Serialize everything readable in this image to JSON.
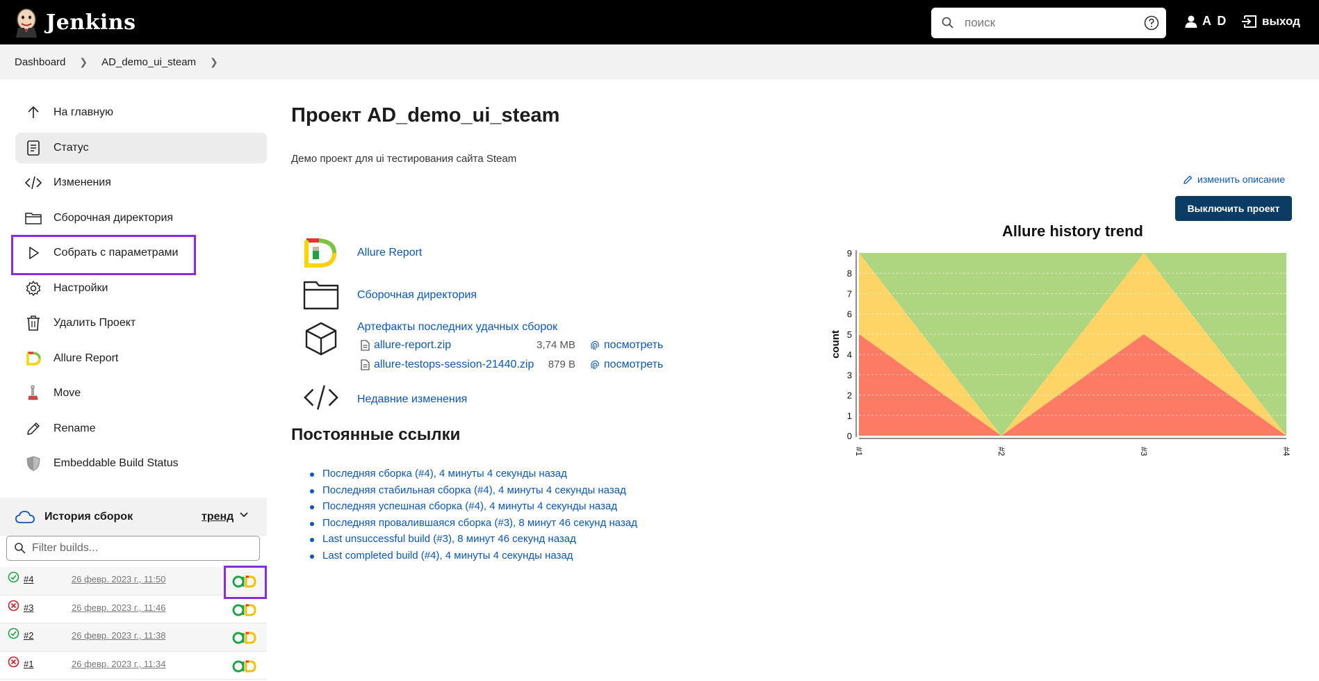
{
  "header": {
    "brand": "Jenkins",
    "search_placeholder": "поиск",
    "user": "A D",
    "logout": "выход"
  },
  "breadcrumb": [
    "Dashboard",
    "AD_demo_ui_steam"
  ],
  "sidebar": {
    "items": [
      {
        "label": "На главную",
        "icon": "arrow-up-icon"
      },
      {
        "label": "Статус",
        "icon": "document-icon",
        "active": true
      },
      {
        "label": "Изменения",
        "icon": "code-icon"
      },
      {
        "label": "Сборочная директория",
        "icon": "folder-icon"
      },
      {
        "label": "Собрать с параметрами",
        "icon": "play-icon",
        "highlighted": true
      },
      {
        "label": "Настройки",
        "icon": "gear-icon"
      },
      {
        "label": "Удалить Проект",
        "icon": "trash-icon"
      },
      {
        "label": "Allure Report",
        "icon": "allure-icon"
      },
      {
        "label": "Move",
        "icon": "move-icon"
      },
      {
        "label": "Rename",
        "icon": "pencil-icon"
      },
      {
        "label": "Embeddable Build Status",
        "icon": "shield-icon"
      }
    ]
  },
  "history": {
    "title": "История сборок",
    "trend": "тренд",
    "filter_placeholder": "Filter builds...",
    "builds": [
      {
        "num": "#4",
        "date": "26 февр. 2023 г., 11:50",
        "status": "success",
        "highlighted": true
      },
      {
        "num": "#3",
        "date": "26 февр. 2023 г., 11:46",
        "status": "failed"
      },
      {
        "num": "#2",
        "date": "26 февр. 2023 г., 11:38",
        "status": "success"
      },
      {
        "num": "#1",
        "date": "26 февр. 2023 г., 11:34",
        "status": "failed"
      }
    ]
  },
  "main": {
    "title": "Проект AD_demo_ui_steam",
    "description": "Демо проект для ui тестирования сайта Steam",
    "edit_description": "изменить описание",
    "disable_button": "Выключить проект",
    "links": {
      "allure": "Allure Report",
      "workspace": "Сборочная директория",
      "artifacts": "Артефакты последних удачных сборок",
      "changes": "Недавние изменения"
    },
    "artifacts": [
      {
        "name": "allure-report.zip",
        "size": "3,74 MB",
        "view": "посмотреть"
      },
      {
        "name": "allure-testops-session-21440.zip",
        "size": "879 B",
        "view": "посмотреть"
      }
    ],
    "permalinks_title": "Постоянные ссылки",
    "permalinks": [
      "Последняя сборка (#4), 4 минуты 4 секунды назад",
      "Последняя стабильная сборка (#4), 4 минуты 4 секунды назад",
      "Последняя успешная сборка (#4), 4 минуты 4 секунды назад",
      "Последняя провалившаяся сборка (#3), 8 минут 46 секунд назад",
      "Last unsuccessful build (#3), 8 минут 46 секунд назад",
      "Last completed build (#4), 4 минуты 4 секунды назад"
    ]
  },
  "chart_data": {
    "type": "area",
    "title": "Allure history trend",
    "xlabel": "",
    "ylabel": "count",
    "categories": [
      "#1",
      "#2",
      "#3",
      "#4"
    ],
    "ylim": [
      0,
      9
    ],
    "yticks": [
      "0",
      "1",
      "2",
      "3",
      "4",
      "5",
      "6",
      "7",
      "8",
      "9"
    ],
    "stacked": true,
    "grid": true,
    "series": [
      {
        "values": [
          5,
          0,
          5,
          0
        ],
        "color": "#fd7b64"
      },
      {
        "values": [
          4,
          0,
          4,
          0
        ],
        "color": "#ffd467"
      },
      {
        "values": [
          0,
          9,
          0,
          9
        ],
        "color": "#aed580"
      }
    ]
  },
  "colors": {
    "highlight": "#8a2be2",
    "link": "#0b57b9",
    "button": "#0c3c64"
  }
}
